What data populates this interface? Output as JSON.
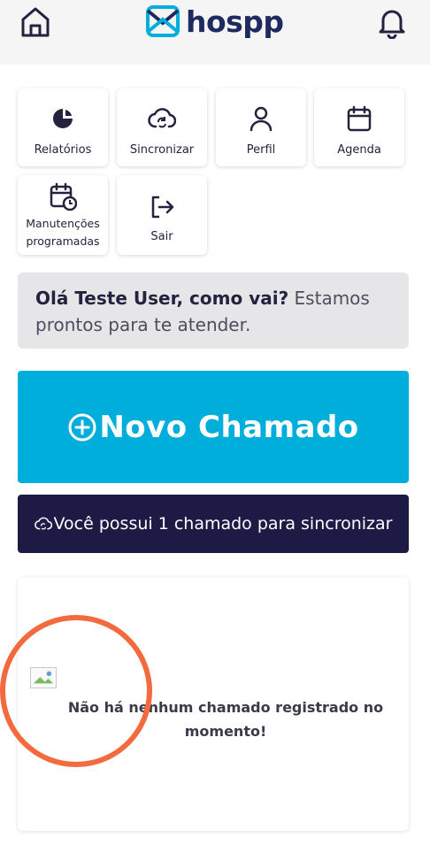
{
  "header": {
    "logo_text": "hospp",
    "icons": {
      "home": "home-icon",
      "notifications": "bell-icon"
    }
  },
  "menu": [
    {
      "label": "Relatórios",
      "icon": "pie-chart-icon"
    },
    {
      "label": "Sincronizar",
      "icon": "cloud-sync-icon"
    },
    {
      "label": "Perfil",
      "icon": "user-icon"
    },
    {
      "label": "Agenda",
      "icon": "calendar-icon"
    },
    {
      "label": "Manutenções programadas",
      "label_line1": "Manutenções",
      "label_line2": "programadas",
      "icon": "calendar-clock-icon"
    },
    {
      "label": "Sair",
      "icon": "logout-icon"
    }
  ],
  "greeting": {
    "bold": "Olá Teste User, como vai?",
    "rest": " Estamos prontos para te atender."
  },
  "new_call": {
    "label": "Novo Chamado",
    "icon": "plus-circle-icon"
  },
  "sync_notice": {
    "label": "Você possui 1 chamado para sincronizar",
    "icon": "cloud-sync-icon"
  },
  "empty_state": {
    "message": "Não há nenhum chamado registrado no momento!"
  },
  "colors": {
    "primary": "#00aedb",
    "dark": "#1d1b45",
    "brand": "#1f2a5e",
    "logo_accent": "#00aedb",
    "highlight": "#f26a3d"
  }
}
